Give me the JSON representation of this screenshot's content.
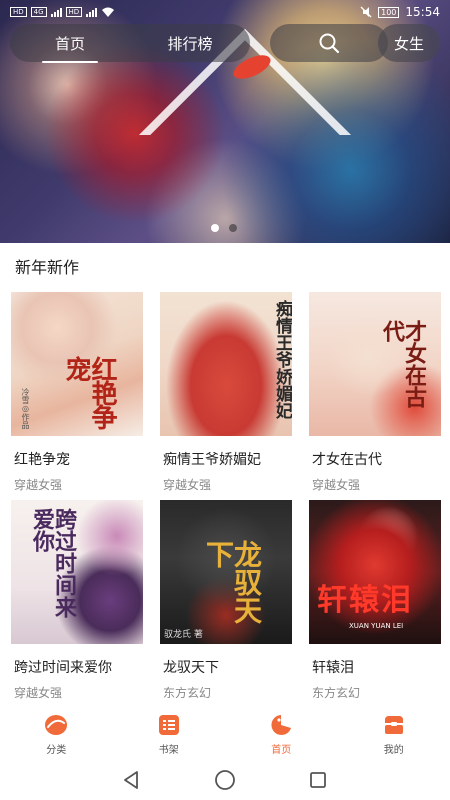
{
  "status_bar": {
    "left_badges": [
      "HD",
      "HD"
    ],
    "network": "4G",
    "time": "15:54",
    "battery": "100"
  },
  "top_nav": {
    "tabs": [
      {
        "label": "首页",
        "active": true
      },
      {
        "label": "排行榜",
        "active": false
      }
    ],
    "search_icon": "search-icon",
    "gender_label": "女生"
  },
  "banner": {
    "slide_count": 2,
    "active_slide": 1
  },
  "section": {
    "title": "新年新作",
    "books": [
      {
        "name": "红艳争宠",
        "category": "穿越女强",
        "cover_text": "红艳争宠",
        "cover_sub": "冷雪◎作品"
      },
      {
        "name": "痴情王爷娇媚妃",
        "category": "穿越女强",
        "cover_text": "痴情王爷娇媚妃",
        "cover_sub": ""
      },
      {
        "name": "才女在古代",
        "category": "穿越女强",
        "cover_text": "才女在古代",
        "cover_sub": ""
      },
      {
        "name": "跨过时间来爱你",
        "category": "穿越女强",
        "cover_text": "跨过时间来爱你",
        "cover_sub": ""
      },
      {
        "name": "龙驭天下",
        "category": "东方玄幻",
        "cover_text": "龙驭天下",
        "cover_sub": "驭龙氏 著"
      },
      {
        "name": "轩辕泪",
        "category": "东方玄幻",
        "cover_text": "轩辕泪",
        "cover_sub": "XUAN YUAN LEI"
      }
    ]
  },
  "tab_bar": {
    "items": [
      {
        "label": "分类",
        "icon": "category-icon",
        "active": false
      },
      {
        "label": "书架",
        "icon": "bookshelf-icon",
        "active": false
      },
      {
        "label": "首页",
        "icon": "home-icon",
        "active": true
      },
      {
        "label": "我的",
        "icon": "profile-icon",
        "active": false
      }
    ]
  },
  "system_nav": [
    "back-icon",
    "home-circle-icon",
    "recents-icon"
  ],
  "colors": {
    "accent": "#f06a3a",
    "nav_pill": "rgba(60,60,70,0.55)"
  }
}
